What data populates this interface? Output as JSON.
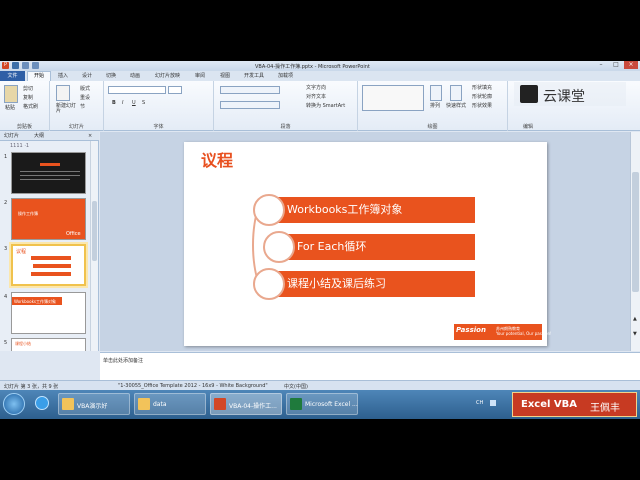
{
  "window": {
    "title": "VBA-04-操作工作簿.pptx - Microsoft PowerPoint"
  },
  "tabs": {
    "file": "文件",
    "home": "开始",
    "insert": "插入",
    "design": "设计",
    "transitions": "切换",
    "animations": "动画",
    "slideshow": "幻灯片放映",
    "review": "审阅",
    "view": "视图",
    "dev": "开发工具",
    "addins": "加载项"
  },
  "ribbon": {
    "clipboard": {
      "group": "剪贴板",
      "paste": "粘贴",
      "cut": "剪切",
      "copy": "复制",
      "format": "格式刷"
    },
    "slides": {
      "group": "幻灯片",
      "new_slide": "新建幻灯片",
      "layout": "版式",
      "reset": "重设",
      "section": "节"
    },
    "font": {
      "group": "字体"
    },
    "paragraph": {
      "group": "段落",
      "text_dir": "文字方向",
      "align": "对齐文本",
      "smartart": "转换为 SmartArt"
    },
    "drawing": {
      "group": "绘图",
      "arrange": "排列",
      "quick_styles": "快速样式",
      "fill": "形状填充",
      "outline": "形状轮廓",
      "effects": "形状效果"
    },
    "editing": {
      "group": "编辑"
    }
  },
  "pane": {
    "tab_slides": "幻灯片",
    "tab_outline": "大纲",
    "ruler": "1111 ·1"
  },
  "thumbnails": [
    {
      "num": "1",
      "title": "VBA Workbooks"
    },
    {
      "num": "2",
      "title": "操作工作簿",
      "sub": "Office"
    },
    {
      "num": "3",
      "title": "议程"
    },
    {
      "num": "4",
      "title": "Workbooks工作簿对象"
    },
    {
      "num": "5",
      "title": "课程小结"
    }
  ],
  "slide": {
    "title": "议程",
    "items": [
      "Workbooks工作簿对象",
      "For Each循环",
      "课程小结及课后练习"
    ],
    "footer_logo": "Passion",
    "footer_text": "苏州朗熟教育\nYour potential, Our passion!"
  },
  "notes": {
    "placeholder": "单击此处添加备注"
  },
  "status": {
    "slide": "幻灯片 第 3 张，共 9 张",
    "theme": "\"1-30055_Office Template 2012 - 16x9 - White Background\"",
    "lang": "中文(中国)"
  },
  "taskbar": {
    "items": [
      "VBA演示好",
      "data",
      "VBA-04-操作工...",
      "Microsoft Excel ..."
    ]
  },
  "watermark": {
    "text": "云课堂"
  },
  "badge": {
    "left": "Excel VBA",
    "right": "王佩丰"
  },
  "colors": {
    "accent": "#e9531e",
    "ribbon": "#dfe7f2"
  }
}
